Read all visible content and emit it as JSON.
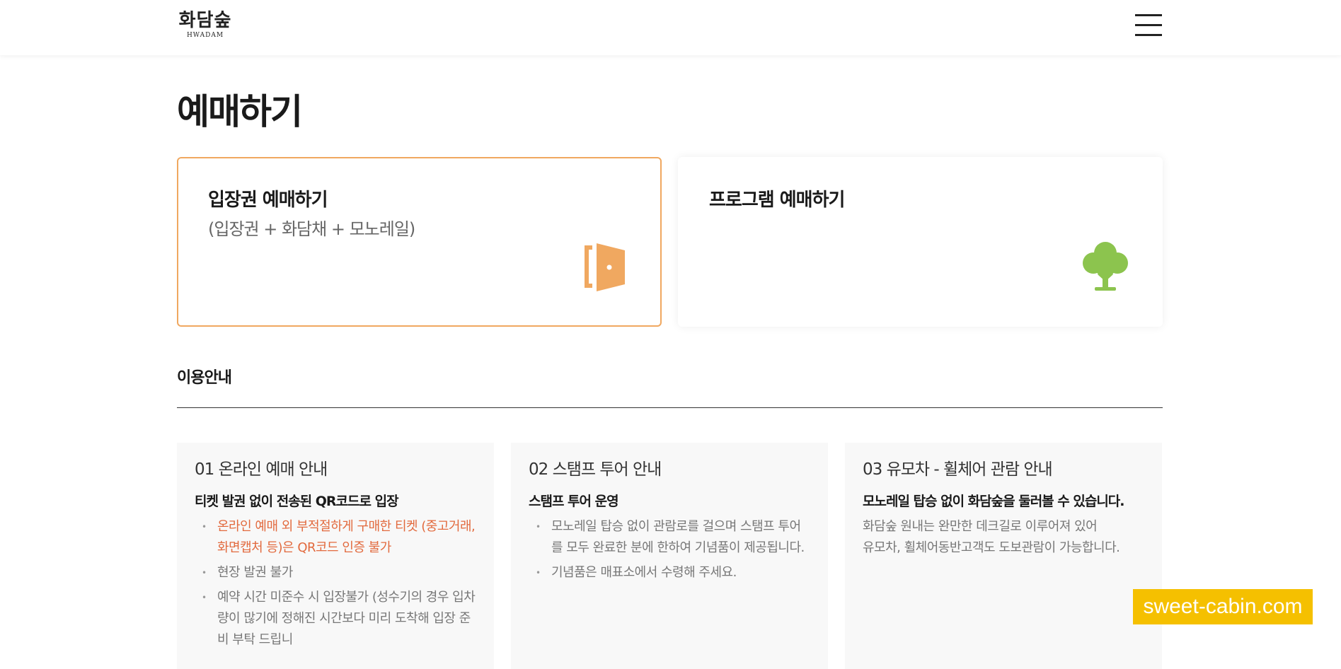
{
  "header": {
    "logo_ko": "화담숲",
    "logo_en": "HWADAM"
  },
  "page": {
    "title": "예매하기"
  },
  "cards": {
    "ticket": {
      "title": "입장권 예매하기",
      "subtitle": "(입장권 + 화담채 + 모노레일)",
      "icon": "door-icon"
    },
    "program": {
      "title": "프로그램 예매하기",
      "icon": "tree-icon"
    }
  },
  "info": {
    "heading": "이용안내",
    "boxes": [
      {
        "title": "01 온라인 예매 안내",
        "subtitle": "티켓 발권 없이 전송된 QR코드로 입장",
        "items": [
          "온라인 예매 외 부적절하게 구매한 티켓 (중고거래, 화면캡처 등)은 QR코드 인증 불가",
          "현장 발권 불가",
          "예약 시간 미준수 시 입장불가 (성수기의 경우 입차량이 많기에 정해진 시간보다 미리 도착해 입장 준비 부탁 드립니"
        ]
      },
      {
        "title": "02 스탬프 투어 안내",
        "subtitle": "스탬프 투어 운영",
        "items": [
          "모노레일 탑승 없이 관람로를 걸으며 스탬프 투어를 모두 완료한 분에 한하여 기념품이 제공됩니다.",
          "기념품은 매표소에서 수령해 주세요."
        ]
      },
      {
        "title": "03 유모차 - 휠체어 관람 안내",
        "subtitle": "모노레일 탑승 없이 화담숲을 둘러볼 수 있습니다.",
        "text_line1": "화담숲 원내는 완만한 데크길로 이루어져 있어",
        "text_line2": "유모차, 휠체어동반고객도 도보관람이 가능합니다."
      }
    ]
  },
  "watermark": "sweet-cabin.com",
  "colors": {
    "accent_orange": "#f0a860",
    "warning_text": "#e26a3e",
    "tree_green": "#8cc44e",
    "watermark_bg": "#f5c000"
  }
}
